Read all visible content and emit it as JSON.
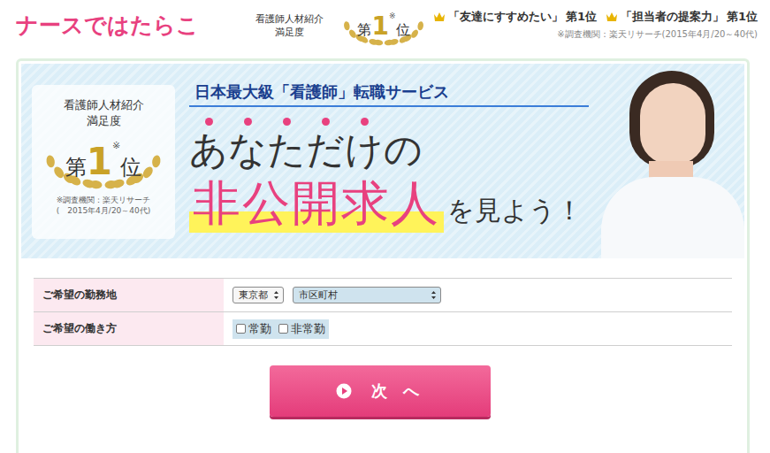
{
  "header": {
    "logo": "ナースではたらこ",
    "award": {
      "line1": "看護師人材紹介",
      "line2": "満足度",
      "rank_prefix": "第",
      "rank_number": "1",
      "rank_suffix": "位",
      "note_mark": "※"
    },
    "rankings": [
      {
        "label": "「友達にすすめたい」",
        "rank": "第1位"
      },
      {
        "label": "「担当者の提案力」",
        "rank": "第1位"
      }
    ],
    "note": "※調査機関：楽天リサーチ(2015年4月/20～40代)"
  },
  "banner": {
    "badge": {
      "line1": "看護師人材紹介",
      "line2": "満足度",
      "rank_prefix": "第",
      "rank_number": "1",
      "rank_suffix": "位",
      "note_mark": "※",
      "source": "※調査機関：楽天リサーチ",
      "period": "(　2015年4月/20～40代)"
    },
    "tagline": "日本最大級「看護師」転職サービス",
    "headline": "あなただけの",
    "emphasis": "非公開求人",
    "headline_end": "を見よう！"
  },
  "form": {
    "rows": [
      {
        "label": "ご希望の勤務地",
        "kind": "selects",
        "selects": [
          {
            "value": "東京都"
          },
          {
            "value": "市区町村"
          }
        ]
      },
      {
        "label": "ご希望の働き方",
        "kind": "checkboxes",
        "options": [
          {
            "label": "常勤",
            "checked": false
          },
          {
            "label": "非常勤",
            "checked": false
          }
        ]
      }
    ]
  },
  "button": {
    "label": "次 へ"
  }
}
